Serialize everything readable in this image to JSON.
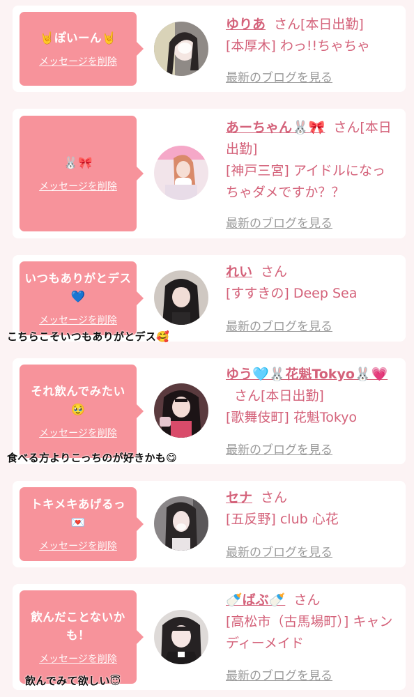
{
  "common": {
    "delete_label": "メッセージを削除",
    "blog_link": "最新のブログを見る"
  },
  "colors": {
    "background": "#fcf3f4",
    "bubble": "#f7939b",
    "name": "#d4627a",
    "muted": "#9a9a9a"
  },
  "cards": [
    {
      "message": "🤘ぽいーん🤘",
      "name": "ゆりあ",
      "suffix": "さん[本日出勤]",
      "area_text": "[本厚木] わっ!!ちゃちゃ",
      "reply": ""
    },
    {
      "message": "🐰🎀",
      "name": "あーちゃん🐰🎀",
      "suffix": "さん[本日出勤]",
      "area_text": "[神戸三宮] アイドルになっちゃダメですか？？",
      "reply": ""
    },
    {
      "message": "いつもありがとデス💙",
      "name": "れい",
      "suffix": "さん",
      "area_text": "[すすきの] Deep Sea",
      "reply": "こちらこそいつもありがとデス🥰"
    },
    {
      "message": "それ飲んでみたい🥹",
      "name": "ゆう🩵🐰花魁Tokyo🐰💗",
      "suffix": "さん[本日出勤]",
      "area_text": "[歌舞伎町] 花魁Tokyo",
      "reply": "食べる方よりこっちのが好きかも😋"
    },
    {
      "message": "トキメキあげるっ💌",
      "name": "セナ",
      "suffix": "さん",
      "area_text": "[五反野] club 心花",
      "reply": ""
    },
    {
      "message": "飲んだことないかも！",
      "name": "🍼ばぶ🍼",
      "suffix": "さん",
      "area_text": "[高松市（古馬場町）] キャンディーメイド",
      "reply": "飲んでみて欲しい😇"
    }
  ]
}
